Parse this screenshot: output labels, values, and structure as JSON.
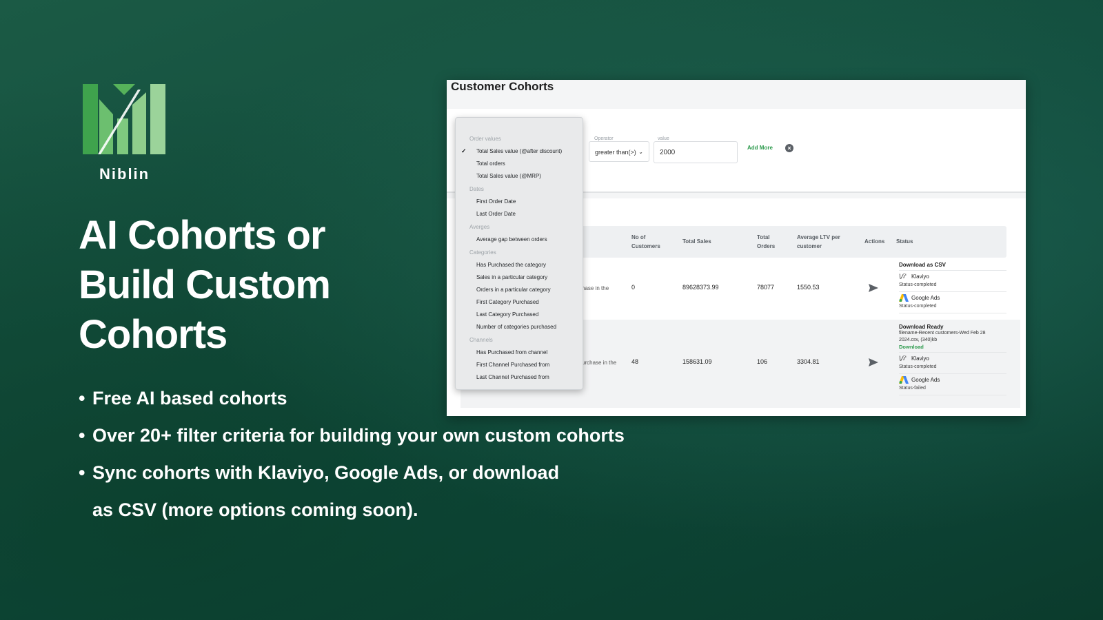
{
  "brand": {
    "name": "Niblin",
    "logo_colors": [
      "#3fa34d",
      "#6cbf6f",
      "#9bd39a"
    ]
  },
  "headline": [
    "AI Cohorts or",
    "Build Custom",
    "Cohorts"
  ],
  "bullets": [
    "Free AI based cohorts",
    "Over 20+ filter criteria for building your own custom cohorts",
    "Sync cohorts with Klaviyo, Google Ads, or download"
  ],
  "bullet_continuation": "as CSV (more options coming soon).",
  "screenshot": {
    "title": "Customer Cohorts",
    "filter": {
      "operator_label": "Operator",
      "operator_value": "greater than(>)",
      "value_label": "value",
      "value": "2000",
      "add_more": "Add More"
    },
    "table": {
      "headers": {
        "customers": "No of Customers",
        "sales": "Total Sales",
        "orders": "Total Orders",
        "ltv": "Average LTV per customer",
        "actions": "Actions",
        "status": "Status"
      },
      "rows": [
        {
          "criteria_fragment": "hase in the",
          "customers": "0",
          "sales": "89628373.99",
          "orders": "78077",
          "ltv": "1550.53",
          "status_title": "Download as CSV",
          "integrations": [
            {
              "name": "Klaviyo",
              "status": "Status-completed"
            },
            {
              "name": "Google Ads",
              "status": "Status-completed"
            }
          ]
        },
        {
          "criteria_fragment": "urchase in the",
          "customers": "48",
          "sales": "158631.09",
          "orders": "106",
          "ltv": "3304.81",
          "status_title": "Download Ready",
          "file_info": "filename-Recent customers-Wed Feb 28 2024.csv, (340)kb",
          "download_link": "Download",
          "integrations": [
            {
              "name": "Klaviyo",
              "status": "Status-completed"
            },
            {
              "name": "Google Ads",
              "status": "Status-failed"
            }
          ]
        }
      ]
    },
    "dropdown": {
      "groups": [
        {
          "label": "Order values",
          "items": [
            "Total Sales value (@after discount)",
            "Total orders",
            "Total Sales value (@MRP)"
          ]
        },
        {
          "label": "Dates",
          "items": [
            "First Order Date",
            "Last Order Date"
          ]
        },
        {
          "label": "Averges",
          "items": [
            "Average gap between orders"
          ]
        },
        {
          "label": "Categories",
          "items": [
            "Has Purchased the category",
            "Sales in a particular category",
            "Orders in a particular category",
            "First Category Purchased",
            "Last Category Purchased",
            "Number of categories purchased"
          ]
        },
        {
          "label": "Channels",
          "items": [
            "Has Purchased from channel",
            "First Channel Purchased from",
            "Last Channel Purchased from"
          ]
        }
      ],
      "selected": "Total Sales value (@after discount)"
    }
  }
}
